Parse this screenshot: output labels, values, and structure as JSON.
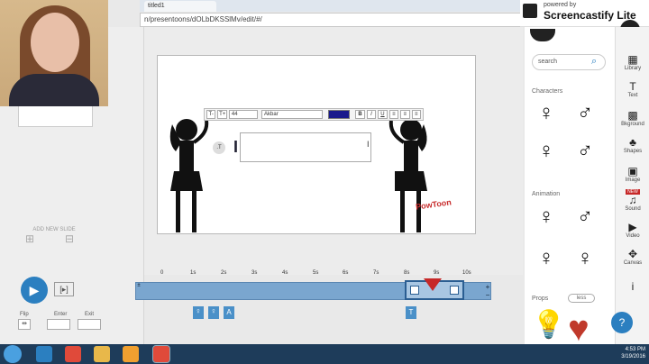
{
  "browser": {
    "url": "n/presentoons/dOLbDKSSlMv/edit/#/",
    "tab_title": "titled1"
  },
  "screencastify": {
    "powered_by": "powered by",
    "name": "Screencastify Lite"
  },
  "left_panel": {
    "add_new_slide": "ADD NEW SLIDE"
  },
  "controls": {
    "flip": "Flip",
    "enter": "Enter",
    "exit": "Exit"
  },
  "format_bar": {
    "font_size": "44",
    "font_name": "Akbar",
    "text_color": "#1a1a8c",
    "buttons": [
      "B",
      "I",
      "U"
    ]
  },
  "timeline": {
    "ticks": [
      "0",
      "1s",
      "2s",
      "3s",
      "4s",
      "5s",
      "6s",
      "7s",
      "8s",
      "9s",
      "10s"
    ]
  },
  "sidebar": {
    "search_placeholder": "search",
    "characters_label": "Characters",
    "animation_label": "Animation",
    "props_label": "Props",
    "less_label": "less"
  },
  "iconbar": [
    {
      "label": "Library",
      "icon": "library-icon"
    },
    {
      "label": "Text",
      "icon": "text-icon"
    },
    {
      "label": "Bkground",
      "icon": "background-icon"
    },
    {
      "label": "Shapes",
      "icon": "shapes-icon"
    },
    {
      "label": "Image",
      "icon": "image-icon"
    },
    {
      "label": "Sound",
      "icon": "sound-icon",
      "badge": "NEW"
    },
    {
      "label": "Video",
      "icon": "video-icon"
    },
    {
      "label": "Canvas",
      "icon": "canvas-icon"
    },
    {
      "label": "",
      "icon": "info-icon"
    }
  ],
  "taskbar": {
    "time": "4:53 PM",
    "date": "3/19/2016"
  },
  "powtoon_logo": "PowToon"
}
